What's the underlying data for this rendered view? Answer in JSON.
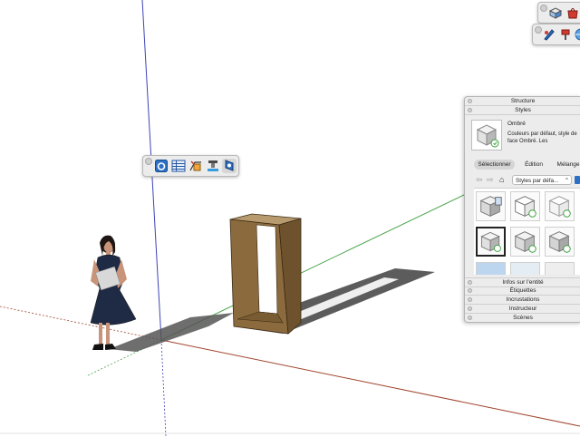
{
  "tray": {
    "sections_top": [
      "Structure",
      "Styles"
    ],
    "style": {
      "name": "Ombré",
      "description": "Couleurs par défaut, style de face Ombré.  Les"
    },
    "tabs": [
      "Sélectionner",
      "Édition",
      "Mélange"
    ],
    "active_tab": "Sélectionner",
    "collection_select": "Styles par défa...",
    "sections_bottom": [
      "Infos sur l'entité",
      "Étiquettes",
      "Incrustations",
      "Instructeur",
      "Scènes"
    ]
  },
  "toolbars": {
    "floating": [
      "styles-icon",
      "table-icon",
      "section-plane-icon",
      "display-section-icon",
      "style-gear-icon"
    ],
    "top_right_1": [
      "cube-icon",
      "red-bag-icon"
    ],
    "top_right_2": [
      "pencil-tool-icon",
      "paint-icon",
      "3d-warehouse-icon"
    ]
  },
  "colors": {
    "axis_blue": "#3d44b8",
    "axis_red": "#a0452e",
    "axis_green": "#4aa34a",
    "wood": "#8b6a3e",
    "shadow": "#555555",
    "panel_bg": "#ececec"
  }
}
